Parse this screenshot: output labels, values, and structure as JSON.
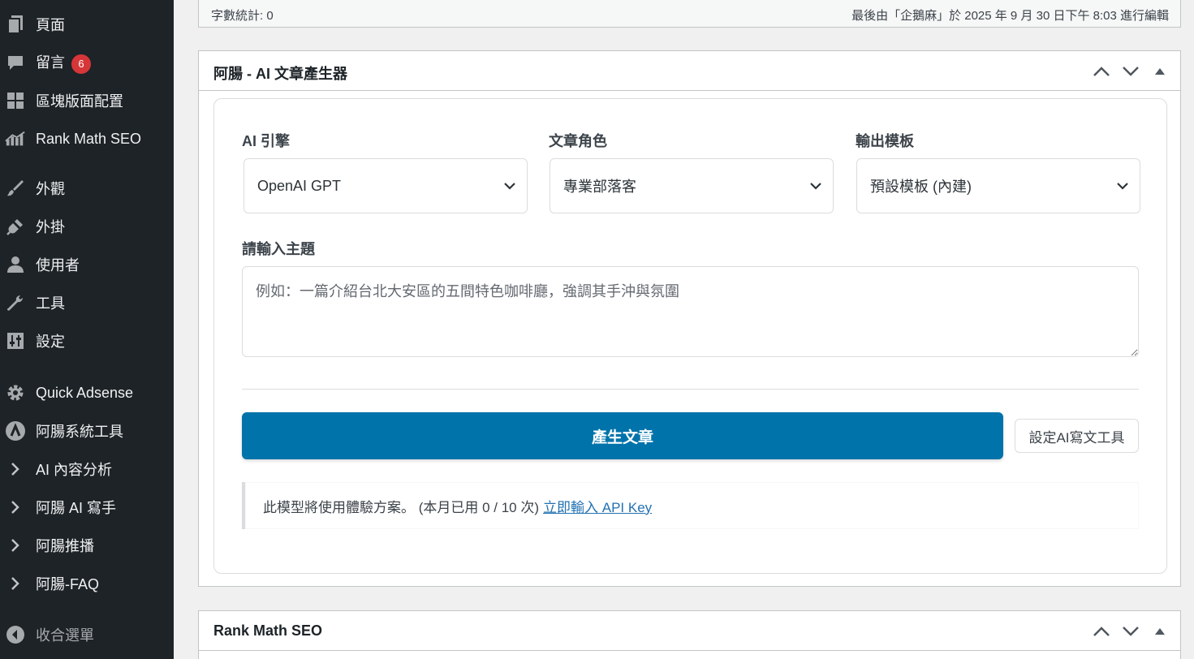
{
  "sidebar": {
    "items": [
      {
        "label": "頁面",
        "icon": "page-icon"
      },
      {
        "label": "留言",
        "icon": "comment-icon",
        "badge": "6"
      },
      {
        "label": "區塊版面配置",
        "icon": "grid-icon"
      },
      {
        "label": "Rank Math SEO",
        "icon": "chart-icon"
      },
      {
        "label": "外觀",
        "icon": "brush-icon"
      },
      {
        "label": "外掛",
        "icon": "plugin-icon"
      },
      {
        "label": "使用者",
        "icon": "user-icon"
      },
      {
        "label": "工具",
        "icon": "wrench-icon"
      },
      {
        "label": "設定",
        "icon": "settings-sliders-icon"
      },
      {
        "label": "Quick Adsense",
        "icon": "gear-icon"
      },
      {
        "label": "阿腸系統工具",
        "icon": "logo-icon"
      },
      {
        "label": "AI 內容分析",
        "icon": "chevron-right-icon"
      },
      {
        "label": "阿腸 AI 寫手",
        "icon": "chevron-right-icon"
      },
      {
        "label": "阿腸推播",
        "icon": "chevron-right-icon"
      },
      {
        "label": "阿腸-FAQ",
        "icon": "chevron-right-icon"
      },
      {
        "label": "收合選單",
        "icon": "collapse-icon"
      }
    ]
  },
  "wordcount": {
    "left": "字數統計: 0",
    "right": "最後由「企鵝麻」於 2025 年 9 月 30 日下午 8:03 進行編輯"
  },
  "generator": {
    "title": "阿腸 - AI 文章產生器",
    "engine_label": "AI 引擎",
    "engine_value": "OpenAI GPT",
    "role_label": "文章角色",
    "role_value": "專業部落客",
    "template_label": "輸出模板",
    "template_value": "預設模板 (內建)",
    "topic_label": "請輸入主題",
    "topic_placeholder": "例如：一篇介紹台北大安區的五間特色咖啡廳，強調其手沖與氛圍",
    "generate_button": "產生文章",
    "settings_button": "設定AI寫文工具",
    "notice_text": "此模型將使用體驗方案。 (本月已用 0 / 10 次)",
    "notice_link": "立即輸入 API Key"
  },
  "rankmath": {
    "title": "Rank Math SEO"
  },
  "colors": {
    "sidebar_bg": "#1d2327",
    "primary_button": "#0073aa",
    "badge": "#d63638",
    "link": "#2271b1"
  }
}
